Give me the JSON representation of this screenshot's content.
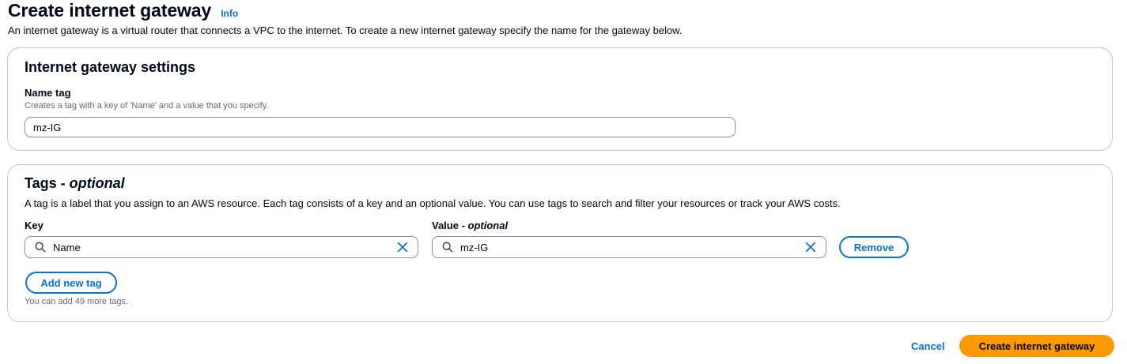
{
  "page": {
    "title": "Create internet gateway",
    "info_label": "Info",
    "description": "An internet gateway is a virtual router that connects a VPC to the internet. To create a new internet gateway specify the name for the gateway below."
  },
  "settings": {
    "heading": "Internet gateway settings",
    "name_tag_label": "Name tag",
    "name_tag_hint": "Creates a tag with a key of 'Name' and a value that you specify.",
    "name_tag_value": "mz-IG"
  },
  "tags": {
    "heading_main": "Tags - ",
    "heading_optional": "optional",
    "description": "A tag is a label that you assign to an AWS resource. Each tag consists of a key and an optional value. You can use tags to search and filter your resources or track your AWS costs.",
    "key_label": "Key",
    "value_label_main": "Value - ",
    "value_label_optional": "optional",
    "rows": [
      {
        "key": "Name",
        "value": "mz-IG",
        "remove_label": "Remove"
      }
    ],
    "add_label": "Add new tag",
    "limit_text": "You can add 49 more tags."
  },
  "footer": {
    "cancel_label": "Cancel",
    "create_label": "Create internet gateway"
  },
  "icons": {
    "search": "search-icon",
    "clear": "close-icon"
  },
  "colors": {
    "accent": "#0972d3",
    "primary_button": "#ff9900",
    "text": "#000716",
    "muted": "#5f6b7a",
    "border": "#c6c6cd"
  }
}
